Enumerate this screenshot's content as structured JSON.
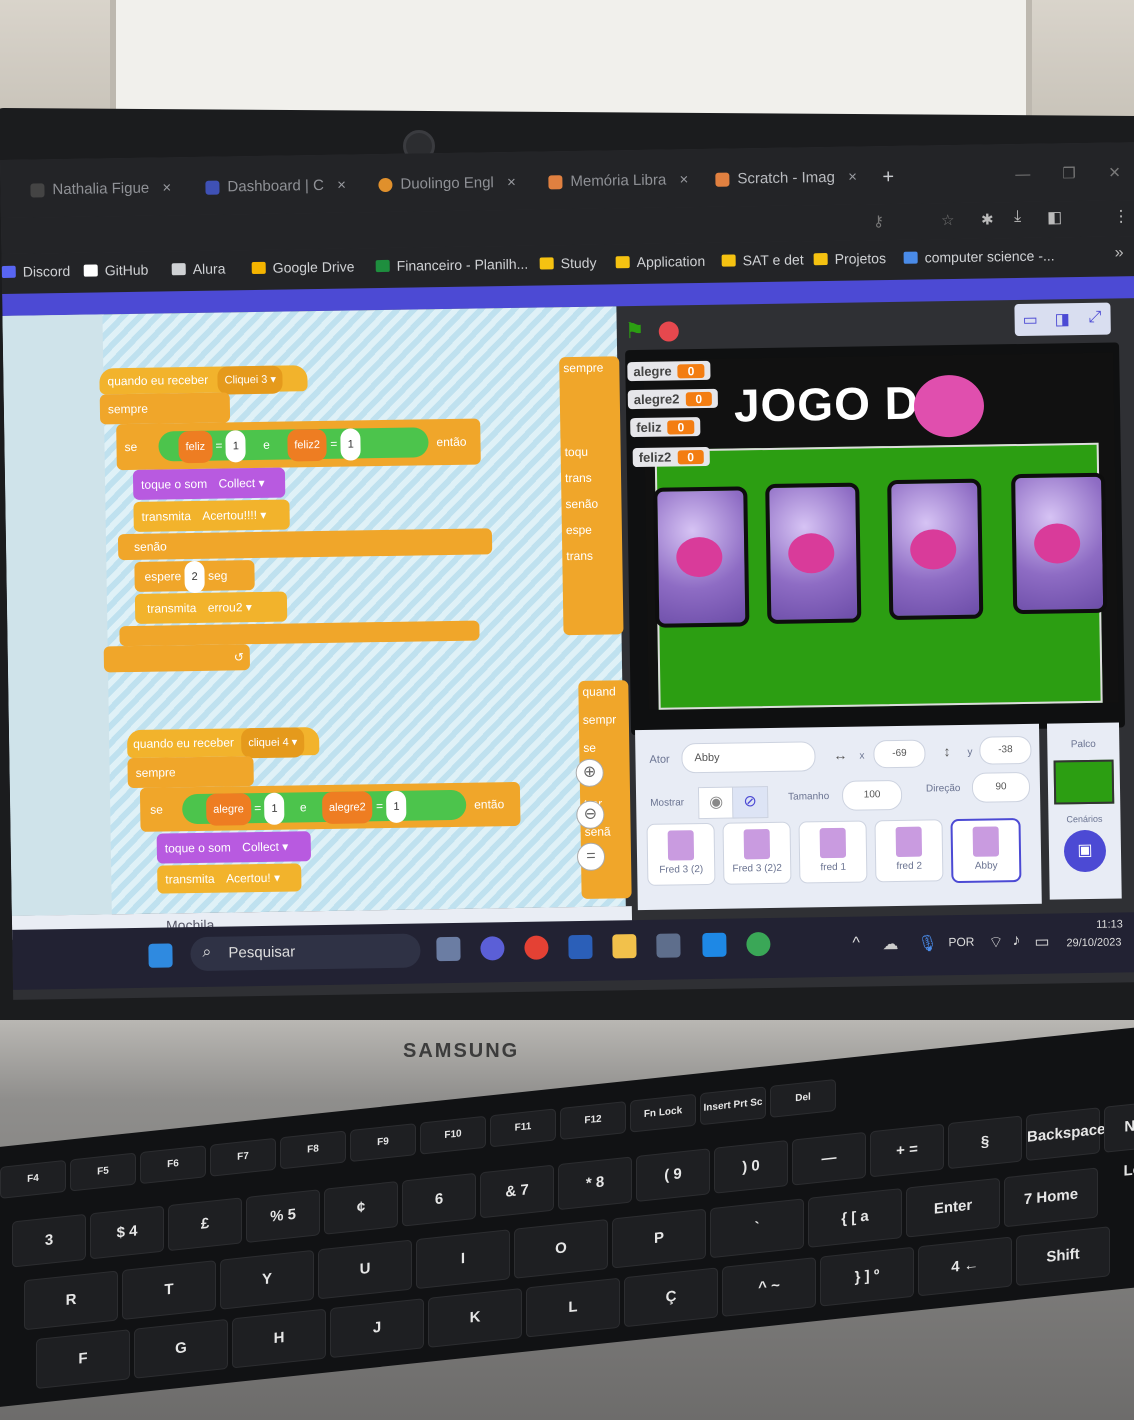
{
  "browser": {
    "tabs": [
      {
        "title": "Nathalia Figue",
        "color": "#444"
      },
      {
        "title": "Dashboard | C",
        "color": "#3f51b5"
      },
      {
        "title": "Duolingo Engl",
        "color": "#e0902c"
      },
      {
        "title": "Memória Libra",
        "color": "#e08040"
      },
      {
        "title": "Scratch - Imag",
        "color": "#e08040"
      }
    ],
    "new_tab": "+",
    "bookmarks": [
      {
        "label": "Discord",
        "color": "#5865f2"
      },
      {
        "label": "GitHub",
        "color": "#ffffff"
      },
      {
        "label": "Alura",
        "color": "#cfd1d4"
      },
      {
        "label": "Google Drive",
        "color": "#f4b400"
      },
      {
        "label": "Financeiro - Planilh...",
        "color": "#1e8e3e"
      },
      {
        "label": "Study",
        "color": "#f5c211"
      },
      {
        "label": "Application",
        "color": "#f5c211"
      },
      {
        "label": "SAT e det",
        "color": "#f5c211"
      },
      {
        "label": "Projetos",
        "color": "#f5c211"
      },
      {
        "label": "computer science -...",
        "color": "#4a8be8"
      }
    ],
    "more_bookmarks": "»"
  },
  "script1": {
    "hat": "quando eu receber",
    "hat_value": "Cliquei 3",
    "forever": "sempre",
    "if": "se",
    "and": "e",
    "then": "então",
    "var1": "feliz",
    "var2": "feliz2",
    "eq": "=",
    "num": "1",
    "sound": "toque o som",
    "sound_value": "Collect",
    "broadcast": "transmita",
    "broadcast_value": "Acertou!!!!",
    "else": "senão",
    "wait": "espere",
    "wait_value": "2",
    "wait_unit": "seg",
    "broadcast2_value": "errou2"
  },
  "script2": {
    "hat": "quando eu receber",
    "hat_value": "cliquei 4",
    "forever": "sempre",
    "if": "se",
    "and": "e",
    "then": "então",
    "var1": "alegre",
    "var2": "alegre2",
    "eq": "=",
    "num": "1",
    "sound": "toque o som",
    "sound_value": "Collect",
    "broadcast": "transmita",
    "broadcast_value": "Acertou!"
  },
  "side_script": {
    "forever": "sempre",
    "sound": "toqu",
    "broadcast": "trans",
    "else": "senão",
    "wait": "espe",
    "broadcast2": "trans",
    "hat2": "quand",
    "forever2": "sempr",
    "wait2": "se",
    "sound2": "toq",
    "trans3": "trar",
    "else2": "senã"
  },
  "backpack": "Mochila",
  "stage": {
    "title": "JOGO DA",
    "monitors": [
      {
        "name": "alegre",
        "value": "0"
      },
      {
        "name": "alegre2",
        "value": "0"
      },
      {
        "name": "feliz",
        "value": "0"
      },
      {
        "name": "feliz2",
        "value": "0"
      }
    ]
  },
  "sprite_info": {
    "sprite_label": "Ator",
    "sprite_name": "Abby",
    "x_label": "x",
    "x": "-69",
    "y_label": "y",
    "y": "-38",
    "show_label": "Mostrar",
    "size_label": "Tamanho",
    "size": "100",
    "direction_label": "Direção",
    "direction": "90",
    "stage_label": "Palco",
    "backdrops_label": "Cenários"
  },
  "sprites": [
    "Fred 3 (2)",
    "Fred 3 (2)2",
    "fred 1",
    "fred 2",
    "Abby"
  ],
  "taskbar": {
    "search": "Pesquisar",
    "lang": "POR",
    "time": "11:13",
    "date": "29/10/2023"
  },
  "laptop": {
    "brand": "SAMSUNG"
  },
  "keyboard": {
    "fn_keys": [
      "F4",
      "F5",
      "F6",
      "F7",
      "F8",
      "F9",
      "F10",
      "F11",
      "F12",
      "Fn Lock",
      "Insert Prt Sc",
      "Del"
    ],
    "number_row": [
      "3",
      "$ 4",
      "£",
      "% 5",
      "¢",
      "6",
      "& 7",
      "* 8",
      "( 9",
      ") 0",
      "—",
      "+ =",
      "§",
      "Backspace",
      "Num Lock"
    ],
    "letters": [
      "R",
      "T",
      "Y",
      "U",
      "I",
      "O",
      "P",
      "`",
      "{ [ a",
      "Enter",
      "7 Home"
    ],
    "bottom": [
      "F",
      "G",
      "H",
      "J",
      "K",
      "L",
      "Ç",
      "^ ~",
      "} ] º",
      "4 ←",
      "Shift"
    ]
  }
}
